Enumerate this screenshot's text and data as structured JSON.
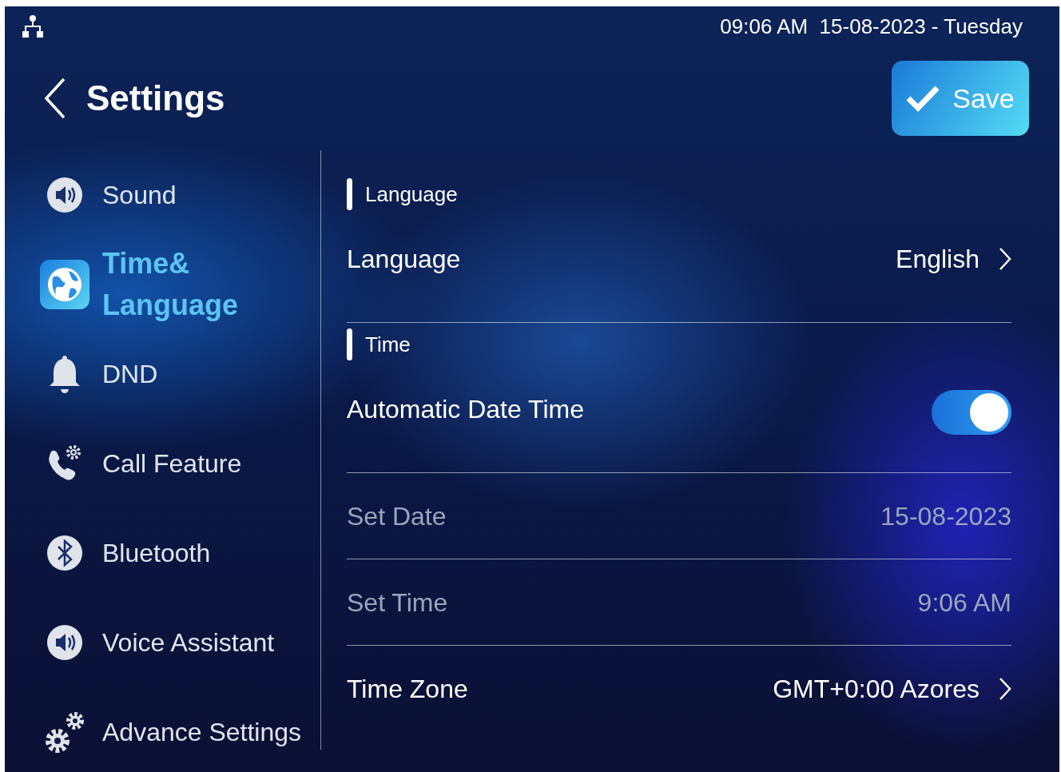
{
  "status_bar": {
    "datetime": "09:06 AM  15-08-2023 - Tuesday"
  },
  "header": {
    "title": "Settings",
    "save_button": "Save"
  },
  "sidebar": {
    "items": [
      {
        "label": "Sound",
        "selected": false
      },
      {
        "label": "Time&\nLanguage",
        "selected": true
      },
      {
        "label": "DND",
        "selected": false
      },
      {
        "label": "Call Feature",
        "selected": false
      },
      {
        "label": "Bluetooth",
        "selected": false
      },
      {
        "label": "Voice Assistant",
        "selected": false
      },
      {
        "label": "Advance Settings",
        "selected": false
      }
    ]
  },
  "sections": [
    {
      "title": "Language",
      "rows": [
        {
          "kind": "nav",
          "label": "Language",
          "value": "English",
          "disabled": false
        }
      ]
    },
    {
      "title": "Time",
      "rows": [
        {
          "kind": "toggle",
          "label": "Automatic Date Time",
          "on": true,
          "disabled": false
        },
        {
          "kind": "value",
          "label": "Set Date",
          "value": "15-08-2023",
          "disabled": true
        },
        {
          "kind": "value",
          "label": "Set Time",
          "value": "9:06 AM",
          "disabled": true
        },
        {
          "kind": "nav",
          "label": "Time Zone",
          "value": "GMT+0:00 Azores",
          "disabled": false
        }
      ]
    }
  ]
}
